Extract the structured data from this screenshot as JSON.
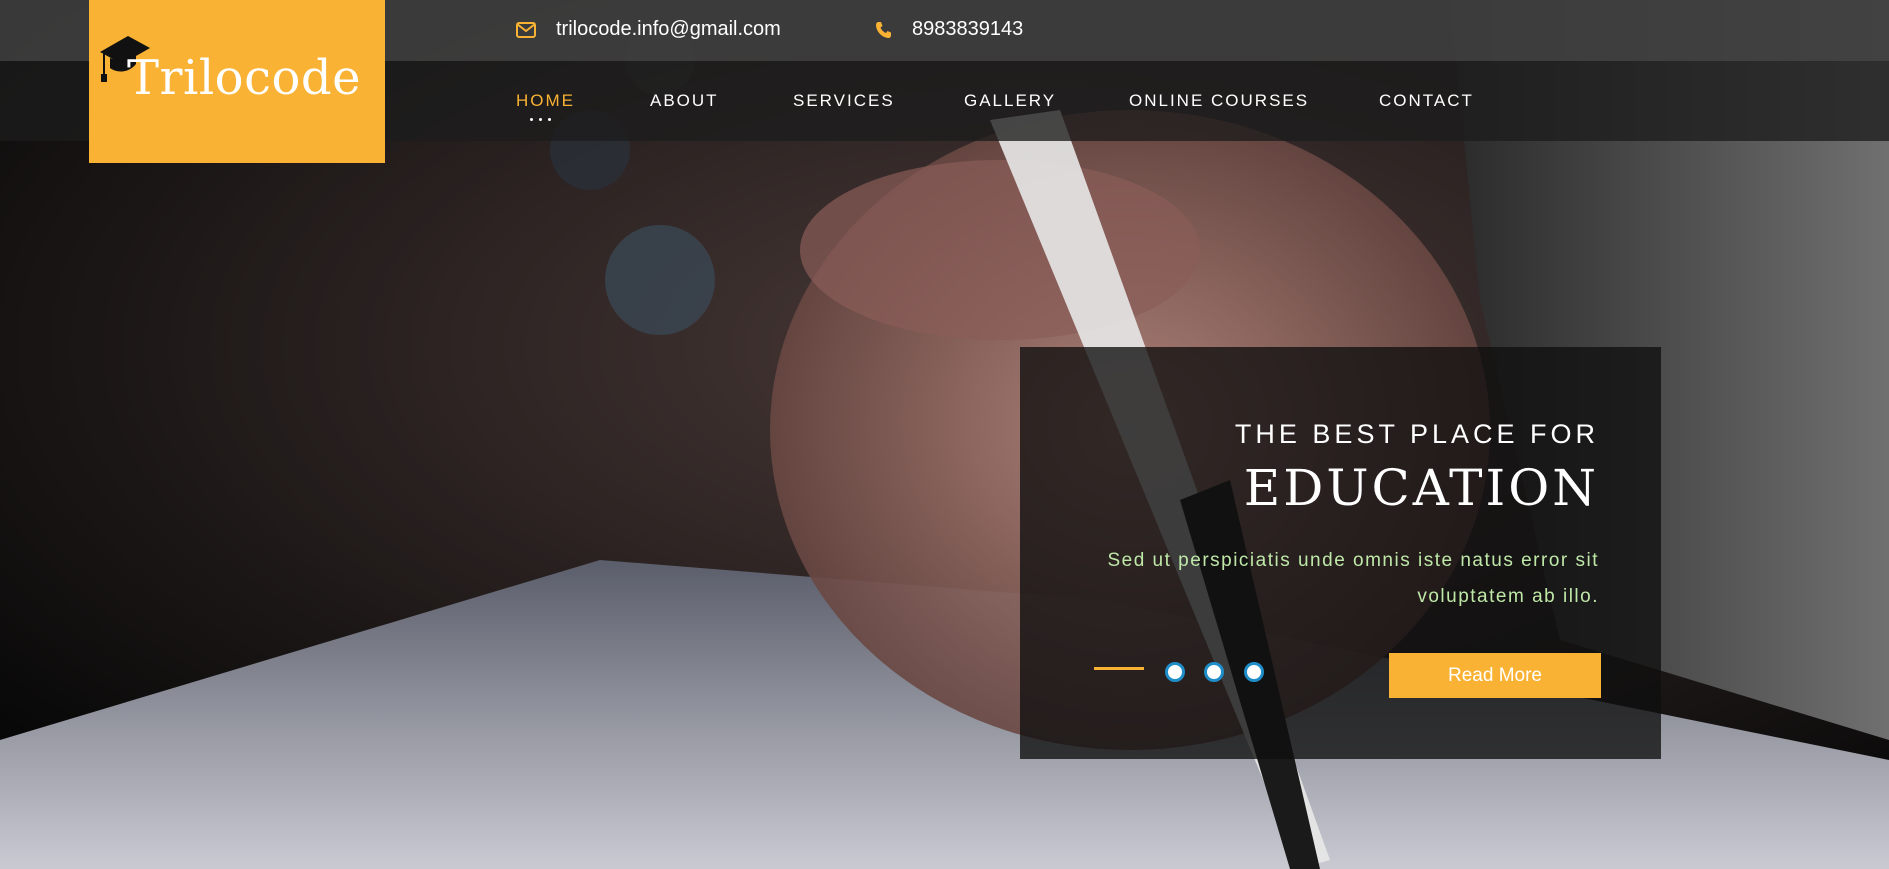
{
  "brand": {
    "name": "Trilocode",
    "color": "#f9b233"
  },
  "topbar": {
    "email": "trilocode.info@gmail.com",
    "phone": "8983839143",
    "email_icon": "envelope-icon",
    "phone_icon": "phone-icon"
  },
  "nav": {
    "items": [
      {
        "label": "HOME",
        "active": true
      },
      {
        "label": "ABOUT",
        "active": false
      },
      {
        "label": "SERVICES",
        "active": false
      },
      {
        "label": "GALLERY",
        "active": false
      },
      {
        "label": "ONLINE COURSES",
        "active": false
      },
      {
        "label": "CONTACT",
        "active": false
      }
    ]
  },
  "hero": {
    "kicker": "THE BEST PLACE FOR",
    "headline": "EDUCATION",
    "description": "Sed ut perspiciatis unde omnis iste natus error sit voluptatem ab illo.",
    "cta_label": "Read More",
    "slides": 3
  },
  "colors": {
    "accent": "#f9b233",
    "slider_dot": "#1e8dc8",
    "description": "#bfe8a8"
  }
}
